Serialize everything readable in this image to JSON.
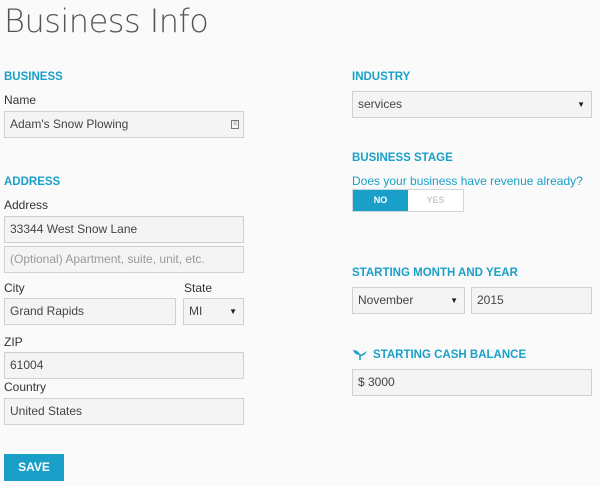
{
  "page": {
    "title": "Business Info"
  },
  "business": {
    "heading": "BUSINESS",
    "name_label": "Name",
    "name_value": "Adam's Snow Plowing"
  },
  "address": {
    "heading": "ADDRESS",
    "address_label": "Address",
    "line1_value": "33344 West Snow Lane",
    "line2_placeholder": "(Optional) Apartment, suite, unit, etc.",
    "city_label": "City",
    "city_value": "Grand Rapids",
    "state_label": "State",
    "state_value": "MI",
    "zip_label": "ZIP",
    "zip_value": "61004",
    "country_label": "Country",
    "country_value": "United States"
  },
  "industry": {
    "heading": "INDUSTRY",
    "value": "services"
  },
  "stage": {
    "heading": "BUSINESS STAGE",
    "question": "Does your business have revenue already?",
    "options": [
      "NO",
      "YES"
    ],
    "selected": "NO"
  },
  "start": {
    "heading": "STARTING MONTH AND YEAR",
    "month_value": "November",
    "year_value": "2015"
  },
  "cash": {
    "heading": "STARTING CASH BALANCE",
    "value": "$ 3000"
  },
  "actions": {
    "save_label": "SAVE"
  },
  "colors": {
    "accent": "#1aa0c8"
  }
}
